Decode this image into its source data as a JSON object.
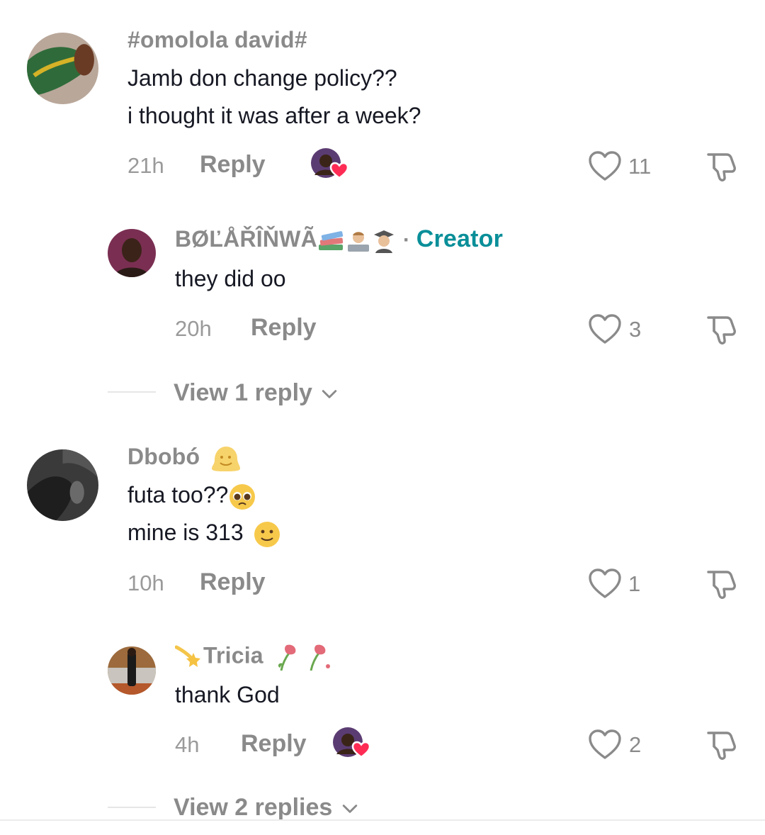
{
  "comments": [
    {
      "username": "#omolola david#",
      "lines": [
        "Jamb don change policy??",
        "i thought it was after a week?"
      ],
      "time": "21h",
      "reply_label": "Reply",
      "likes": "11",
      "creator_liked": true,
      "replies": [
        {
          "username": "BØĽÅŘÎŇWÃ",
          "badge": "Creator",
          "lines": [
            "they did oo"
          ],
          "time": "20h",
          "reply_label": "Reply",
          "likes": "3"
        }
      ],
      "view_more": "View 1 reply"
    },
    {
      "username": "Dbobó",
      "lines": [
        "futa too??",
        "mine is 313"
      ],
      "time": "10h",
      "reply_label": "Reply",
      "likes": "1",
      "replies": [
        {
          "username": "Tricia",
          "lines": [
            "thank God"
          ],
          "time": "4h",
          "reply_label": "Reply",
          "likes": "2",
          "creator_liked": true
        }
      ],
      "view_more": "View 2 replies"
    }
  ],
  "colors": {
    "creator_badge": "#0a8f99",
    "muted": "#8a8a8a",
    "heart_badge": "#fe2c55"
  }
}
